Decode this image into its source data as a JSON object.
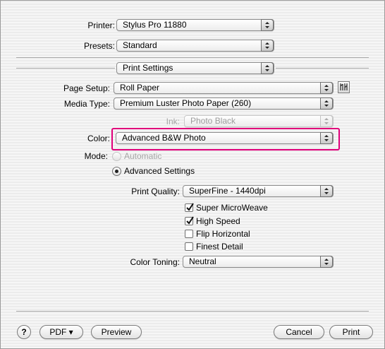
{
  "printer": {
    "label": "Printer:",
    "value": "Stylus Pro 11880"
  },
  "presets": {
    "label": "Presets:",
    "value": "Standard"
  },
  "section": {
    "value": "Print Settings"
  },
  "page_setup": {
    "label": "Page Setup:",
    "value": "Roll Paper",
    "icon": "roll-settings-icon"
  },
  "media_type": {
    "label": "Media Type:",
    "value": "Premium Luster Photo Paper (260)"
  },
  "ink": {
    "label": "Ink:",
    "value": "Photo Black"
  },
  "color": {
    "label": "Color:",
    "value": "Advanced B&W Photo",
    "highlight_color": "#e0007a"
  },
  "mode": {
    "label": "Mode:",
    "automatic": "Automatic",
    "advanced": "Advanced Settings",
    "selected": "Advanced Settings"
  },
  "print_quality": {
    "label": "Print Quality:",
    "value": "SuperFine - 1440dpi"
  },
  "checkboxes": [
    {
      "label": "Super MicroWeave",
      "checked": true
    },
    {
      "label": "High Speed",
      "checked": true
    },
    {
      "label": "Flip Horizontal",
      "checked": false
    },
    {
      "label": "Finest Detail",
      "checked": false
    }
  ],
  "color_toning": {
    "label": "Color Toning:",
    "value": "Neutral"
  },
  "footer": {
    "help": "?",
    "pdf": "PDF ▾",
    "preview": "Preview",
    "cancel": "Cancel",
    "print": "Print"
  }
}
